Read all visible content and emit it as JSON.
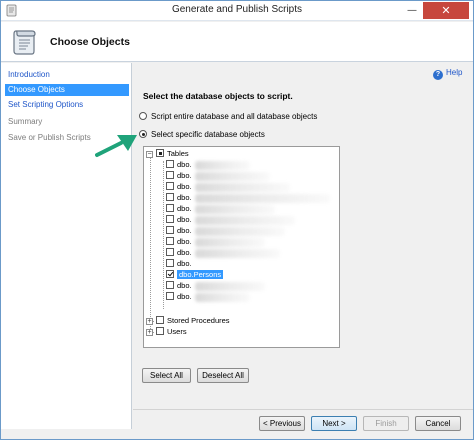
{
  "window": {
    "title": "Generate and Publish Scripts",
    "minimize_glyph": "—",
    "close_glyph": "✕"
  },
  "header": {
    "title": "Choose Objects"
  },
  "nav": {
    "items": [
      {
        "label": "Introduction",
        "state": "link"
      },
      {
        "label": "Choose Objects",
        "state": "active"
      },
      {
        "label": "Set Scripting Options",
        "state": "link"
      },
      {
        "label": "Summary",
        "state": "disabled"
      },
      {
        "label": "Save or Publish Scripts",
        "state": "disabled"
      }
    ]
  },
  "content": {
    "help_label": "Help",
    "help_glyph": "?",
    "instruction": "Select the database objects to script.",
    "radio_entire": "Script entire database and all database objects",
    "radio_specific": "Select specific database objects",
    "selected_radio": "specific"
  },
  "tree": {
    "root_label": "Tables",
    "root_expander": "−",
    "table_rows": [
      {
        "label": "dbo.",
        "checked": false
      },
      {
        "label": "dbo.",
        "checked": false
      },
      {
        "label": "dbo.",
        "checked": false
      },
      {
        "label": "dbo.",
        "checked": false
      },
      {
        "label": "dbo.",
        "checked": false
      },
      {
        "label": "dbo.",
        "checked": false
      },
      {
        "label": "dbo.",
        "checked": false
      },
      {
        "label": "dbo.",
        "checked": false
      },
      {
        "label": "dbo.",
        "checked": false
      },
      {
        "label": "dbo.",
        "checked": false
      },
      {
        "label": "dbo.Persons",
        "checked": true,
        "selected": true
      },
      {
        "label": "dbo.",
        "checked": false
      },
      {
        "label": "dbo.",
        "checked": false
      }
    ],
    "stored_procedures_label": "Stored Procedures",
    "users_label": "Users",
    "collapsed_expander": "+"
  },
  "buttons": {
    "select_all": "Select All",
    "deselect_all": "Deselect All",
    "previous": "< Previous",
    "next": "Next >",
    "finish": "Finish",
    "cancel": "Cancel"
  },
  "colors": {
    "selection": "#3399ff",
    "link": "#1f56c9",
    "arrow": "#1fa37a",
    "close_button": "#c7473d"
  }
}
